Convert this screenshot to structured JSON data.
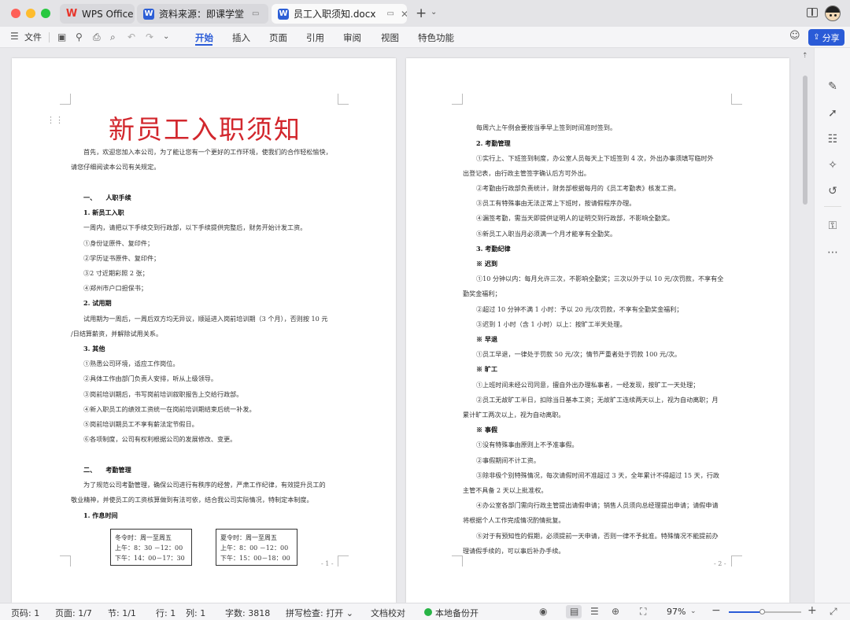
{
  "window": {
    "brand_tab": "WPS Office",
    "tabs": [
      {
        "label": "资料来源：即课学堂"
      },
      {
        "label": "员工入职须知.docx"
      }
    ]
  },
  "toolbar": {
    "file_label": "文件",
    "menus": [
      "开始",
      "插入",
      "页面",
      "引用",
      "审阅",
      "视图",
      "特色功能"
    ],
    "share_label": "分享"
  },
  "page1": {
    "title": "新员工入职须知",
    "lines": [
      "首先，欢迎您加入本公司，为了能让您有一个更好的工作环境，使我们的合作轻松愉快，",
      "请您仔细阅读本公司有关规定。",
      "一、　　人职手续",
      "1.  新员工入职",
      "一周内，请把以下手续交到行政部，以下手续提供完整后，财务开始计发工资。",
      "①身份证原件、复印件；",
      "②学历证书原件、复印件；",
      "③2 寸近期彩照 2 张；",
      "④郑州市户口担保书；",
      "2.  试用期",
      "试用期为一周后，一周后双方均无异议，顺延进入岗前培训期（3 个月），否则按 10 元",
      "/日结算薪资，并解除试用关系。",
      "3.  其他",
      "①熟悉公司环境，适应工作岗位。",
      "②具体工作由部门负责人安排，听从上级领导。",
      "③岗前培训期后，书写岗前培训叙职报告上交给行政部。",
      "④新入职员工的绩效工资统一在岗前培训期结束后统一补发。",
      "⑤岗前培训期员工不享有薪法定节假日。",
      "⑥各项制度，公司有权利根据公司的发展修改、变更。",
      "二、　　考勤管理",
      "为了规范公司考勤管理，确保公司进行有秩序的经营，严肃工作纪律，有效提升员工的",
      "敬业精神，并使员工的工资核算做到有法可依，结合我公司实际情况，特制定本制度。",
      "1.  作息时间"
    ],
    "box1": [
      "冬令时：周一至周五",
      "上午：8：30 －12：00",
      "下午：14：00－17：30"
    ],
    "box2": [
      "夏令时：周一至周五",
      "上午：8：00 －12：00",
      "下午：15：00－18：00"
    ],
    "page_number": "- 1 -"
  },
  "page2": {
    "lines": [
      "每周六上午例会要按当季早上签到时间准时签到。",
      "2.  考勤管理",
      "①实行上、下班签到制度，办公室人员每天上下班签到 4 次，外出办事须填写临时外",
      "出登记表，由行政主管签字确认后方可外出。",
      "②考勤由行政部负责统计，财务部根据每月的《员工考勤表》核发工资。",
      "③员工有特殊事由无法正常上下班时，按请假程序办理。",
      "④漏签考勤，需当天即提供证明人的证明交到行政部，不影响全勤奖。",
      "⑤新员工入职当月必须满一个月才能享有全勤奖。",
      "3.  考勤纪律",
      "※ 迟到",
      "①10 分钟以内：每月允许三次，不影响全勤奖；三次以外于以 10 元/次罚款，不享有全",
      "勤奖金福利；",
      "②超过 10 分钟不满 1 小时：予以 20 元/次罚款，不享有全勤奖金福利；",
      "③迟到 1 小时（含 1 小时）以上：按旷工半天处理。",
      "※ 早退",
      "①员工早退，一律处于罚款 50 元/次；情节严重者处于罚款 100 元/次。",
      "※ 旷工",
      "①上班时间未经公司同意，擅自外出办理私事者，一经发现，按旷工一天处理；",
      "②员工无故旷工半日，扣除当日基本工资；无故旷工连续两天以上，视为自动离职；月",
      "累计旷工两次以上，视为自动离职。",
      "※ 事假",
      "①没有特殊事由原则上不予准事假。",
      "②事假期间不计工资。",
      "③除非极个别特殊情况，每次请假时间不准超过 3 天，全年累计不得超过 15 天，行政",
      "主管不具备 2 天以上批准权。",
      "④办公室各部门需向行政主管提出请假申请；销售人员须向总经理提出申请；请假申请",
      "将根据个人工作完成情况酌情批复。",
      "⑤对于有预知性的假期，必须提前一天申请，否则一律不予批准。特殊情况不能提前办",
      "理请假手续的，可以事后补办手续。"
    ],
    "page_number": "- 2 -"
  },
  "statusbar": {
    "page_code": "页码: 1",
    "page": "页面: 1/7",
    "section": "节: 1/1",
    "row": "行: 1",
    "col": "列: 1",
    "word_count": "字数: 3818",
    "spell_check": "拼写检查: 打开 ⌄",
    "proofread": "文档校对",
    "backup": "本地备份开",
    "zoom": "97%"
  },
  "colors": {
    "accent": "#2a5bd7",
    "title_red": "#d2272d",
    "wps_red": "#e8352b"
  },
  "icons": [
    "close-icon",
    "minimize-icon",
    "maximize-icon",
    "wps-logo-icon",
    "word-doc-icon",
    "plus-icon",
    "chevron-down-icon",
    "sidebar-icon",
    "avatar",
    "menu-icon",
    "save-icon",
    "share-link-icon",
    "print-icon",
    "print-preview-icon",
    "undo-icon",
    "redo-icon",
    "more-chevron-icon",
    "comment-icon",
    "share-icon",
    "pen-icon",
    "select-icon",
    "settings-sliders-icon",
    "ai-icon",
    "history-icon",
    "lock-icon",
    "more-icon",
    "eye-icon",
    "outline-icon",
    "web-icon",
    "fit-icon",
    "zoom-out-icon",
    "zoom-in-icon",
    "fullscreen-icon"
  ]
}
